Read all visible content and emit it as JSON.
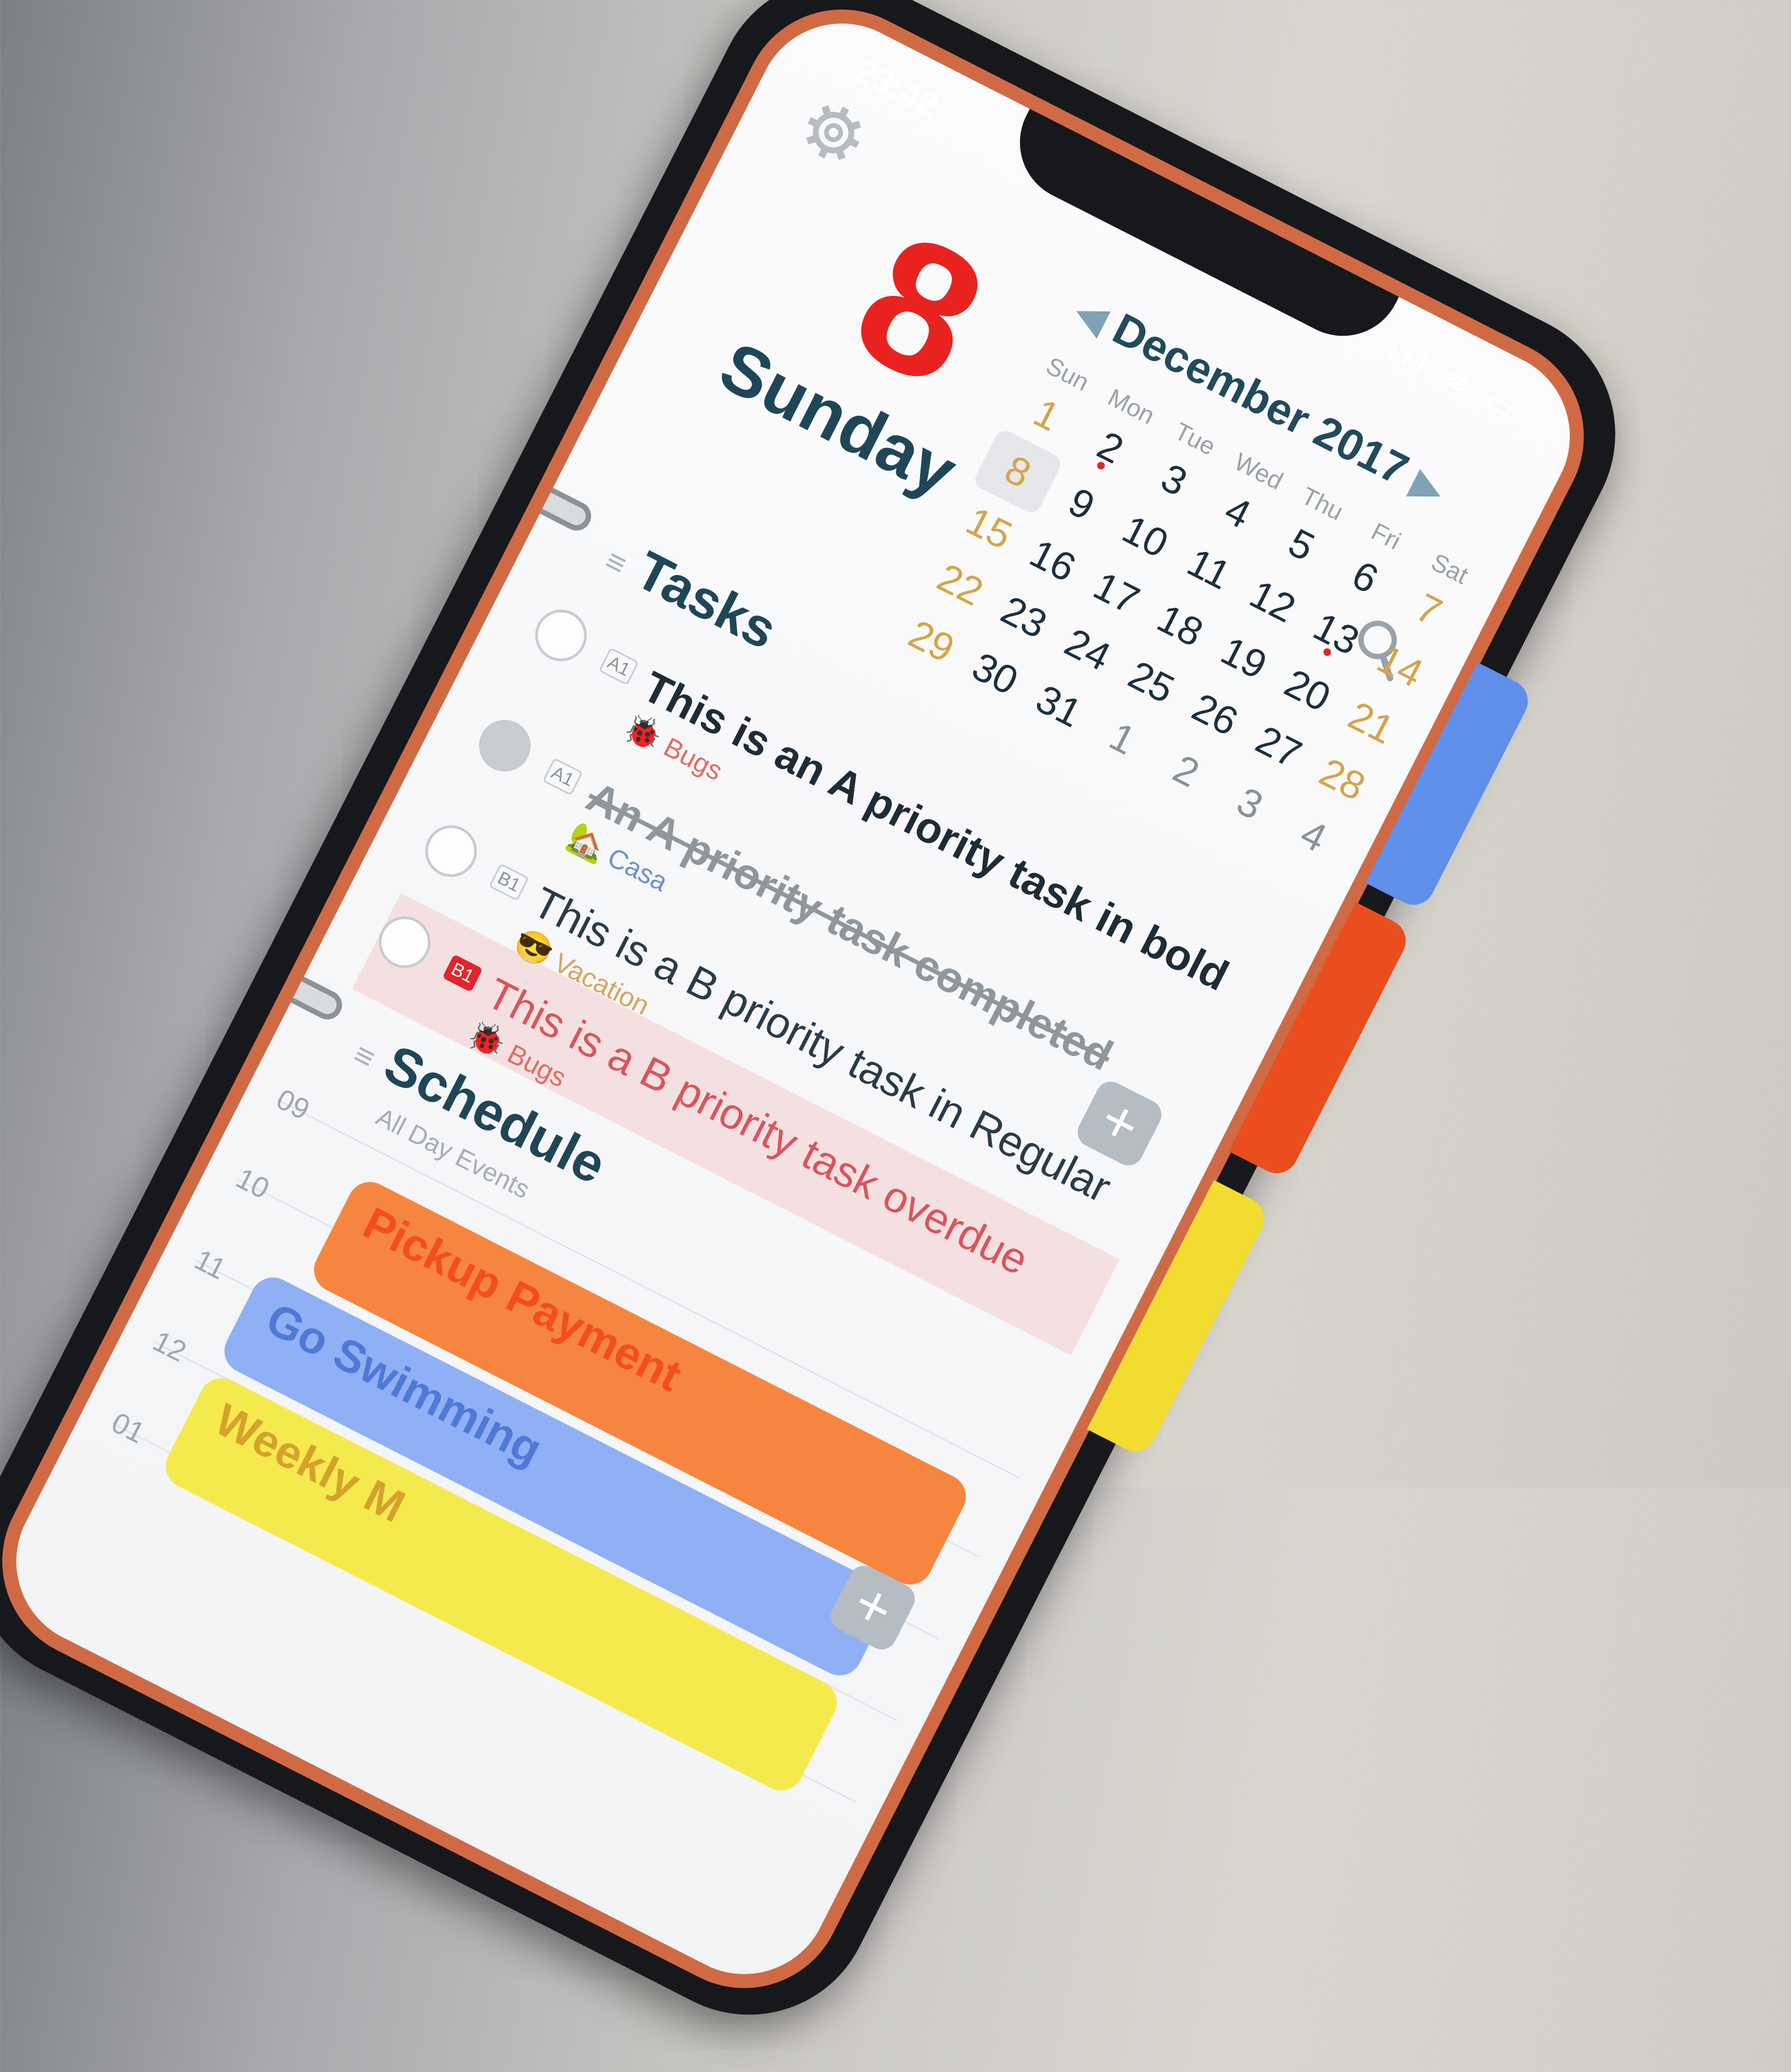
{
  "status": {
    "time": "23:42",
    "icons_text": "ııl ≋ ▭"
  },
  "header": {
    "day_number": "8",
    "weekday": "Sunday",
    "month_year": "December 2017",
    "prev_glyph": "◀",
    "next_glyph": "▶"
  },
  "calendar": {
    "weekdays": [
      "Sun",
      "Mon",
      "Tue",
      "Wed",
      "Thu",
      "Fri",
      "Sat"
    ],
    "weeks": [
      [
        "1",
        "2",
        "3",
        "4",
        "5",
        "6",
        "7"
      ],
      [
        "8",
        "9",
        "10",
        "11",
        "12",
        "13",
        "14"
      ],
      [
        "15",
        "16",
        "17",
        "18",
        "19",
        "20",
        "21"
      ],
      [
        "22",
        "23",
        "24",
        "25",
        "26",
        "27",
        "28"
      ],
      [
        "29",
        "30",
        "31",
        "1",
        "2",
        "3",
        "4"
      ]
    ]
  },
  "tasks": {
    "title": "Tasks",
    "handle": "≡",
    "items": [
      {
        "priority": "A1",
        "title": "This is an A priority task in bold",
        "tag": "Bugs",
        "emoji": "🐞",
        "completed": false
      },
      {
        "priority": "A1",
        "title": "An A priority task completed",
        "tag": "Casa",
        "emoji": "🏡",
        "completed": true
      },
      {
        "priority": "B1",
        "title": "This is a B priority task in Regular",
        "tag": "Vacation",
        "emoji": "😎",
        "completed": false
      },
      {
        "priority": "B1",
        "title": "This is a B priority task overdue",
        "tag": "Bugs",
        "emoji": "🐞",
        "completed": false
      }
    ]
  },
  "schedule": {
    "title": "Schedule",
    "handle": "≡",
    "all_day_label": "All Day Events",
    "hours": [
      "09",
      "10",
      "11",
      "12",
      "01"
    ],
    "events": [
      {
        "title": "Pickup Payment"
      },
      {
        "title": "Go Swimming"
      },
      {
        "title": "Weekly M"
      }
    ]
  },
  "buttons": {
    "add_glyph": "+"
  },
  "colors": {
    "accent_red": "#e3242b",
    "frame_copper": "#d06a45",
    "tab_blue": "#5f8fe9",
    "tab_orange": "#ea4e1e",
    "tab_yellow": "#f1dc2f"
  }
}
